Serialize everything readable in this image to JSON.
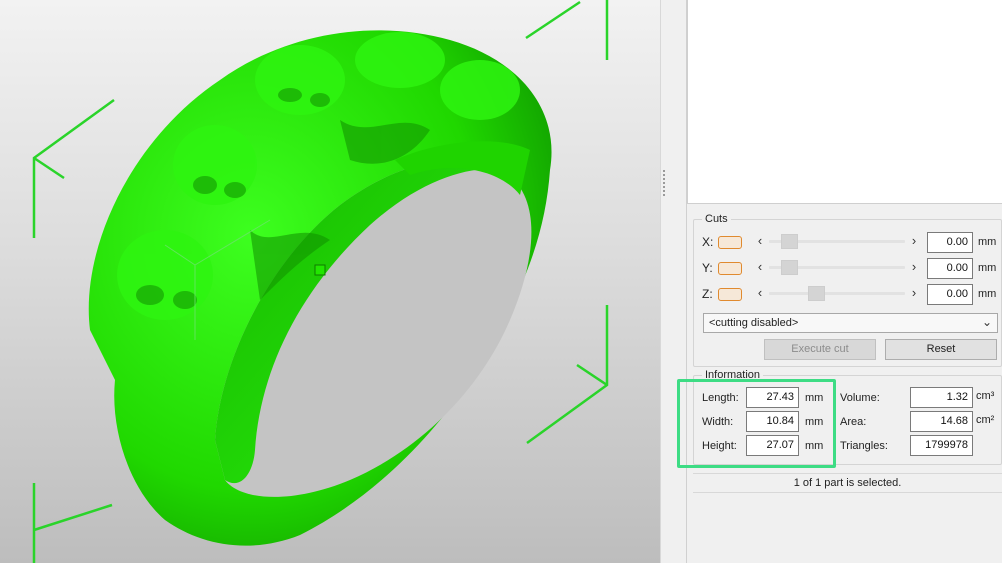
{
  "viewport": {
    "model_color": "#22e600",
    "bbox_color": "#2ad42a"
  },
  "cuts": {
    "title": "Cuts",
    "axes": [
      {
        "label": "X:",
        "value": "0.00",
        "unit": "mm",
        "slider_position": 0.1
      },
      {
        "label": "Y:",
        "value": "0.00",
        "unit": "mm",
        "slider_position": 0.1
      },
      {
        "label": "Z:",
        "value": "0.00",
        "unit": "mm",
        "slider_position": 0.33
      }
    ],
    "slider_left": "‹",
    "slider_right": "›",
    "mode_select": "<cutting disabled>",
    "execute_label": "Execute cut",
    "reset_label": "Reset"
  },
  "information": {
    "title": "Information",
    "length_label": "Length:",
    "length_value": "27.43",
    "length_unit": "mm",
    "width_label": "Width:",
    "width_value": "10.84",
    "width_unit": "mm",
    "height_label": "Height:",
    "height_value": "27.07",
    "height_unit": "mm",
    "volume_label": "Volume:",
    "volume_value": "1.32",
    "volume_unit": "cm³",
    "area_label": "Area:",
    "area_value": "14.68",
    "area_unit": "cm²",
    "triangles_label": "Triangles:",
    "triangles_value": "1799978"
  },
  "status": {
    "selection_text": "1 of 1 part is selected."
  },
  "colors": {
    "highlight": "#3ddc84",
    "toggle_accent": "#e08a2f"
  }
}
